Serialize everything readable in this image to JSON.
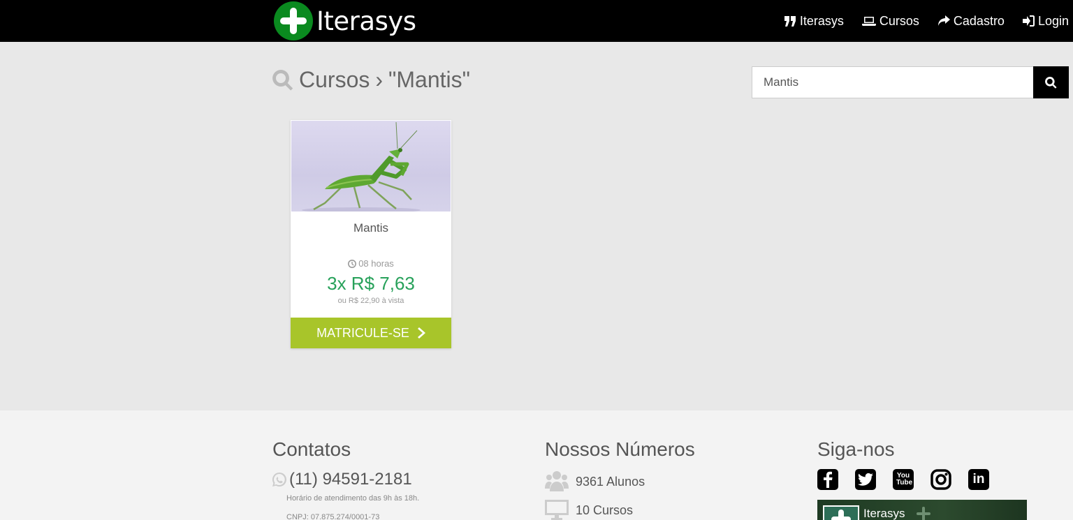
{
  "navbar": {
    "brand": "Iterasys",
    "items": [
      {
        "label": "Iterasys",
        "icon": "quote-icon"
      },
      {
        "label": "Cursos",
        "icon": "laptop-icon"
      },
      {
        "label": "Cadastro",
        "icon": "share-icon"
      },
      {
        "label": "Login",
        "icon": "sign-in-icon"
      }
    ]
  },
  "search": {
    "breadcrumb_section": "Cursos",
    "breadcrumb_sep": "›",
    "breadcrumb_query": "\"Mantis\"",
    "input_value": "Mantis"
  },
  "course": {
    "title": "Mantis",
    "duration": "08 horas",
    "installments": "3x R$ 7,63",
    "cash_price": "ou R$ 22,90 à vista",
    "button_label": "MATRICULE-SE"
  },
  "footer": {
    "contacts": {
      "heading": "Contatos",
      "phone": "(11) 94591-2181",
      "hours": "Horário de atendimento das 9h às 18h.",
      "cnpj": "CNPJ: 07.875.274/0001-73"
    },
    "numbers": {
      "heading": "Nossos Números",
      "students": "9361 Alunos",
      "courses": "10 Cursos"
    },
    "social": {
      "heading": "Siga-nos",
      "networks": [
        "facebook-icon",
        "twitter-icon",
        "youtube-icon",
        "instagram-icon",
        "linkedin-icon"
      ],
      "youtube_glyph": "You Tube",
      "linkedin_glyph": "in",
      "widget_name": "Iterasys"
    }
  },
  "colors": {
    "navbar": "#000000",
    "brand_green": "#0a8a1f",
    "price_green": "#27a15a",
    "button_green": "#a8c52a",
    "background": "#e8e8e8",
    "footer": "#f3f3f3"
  }
}
